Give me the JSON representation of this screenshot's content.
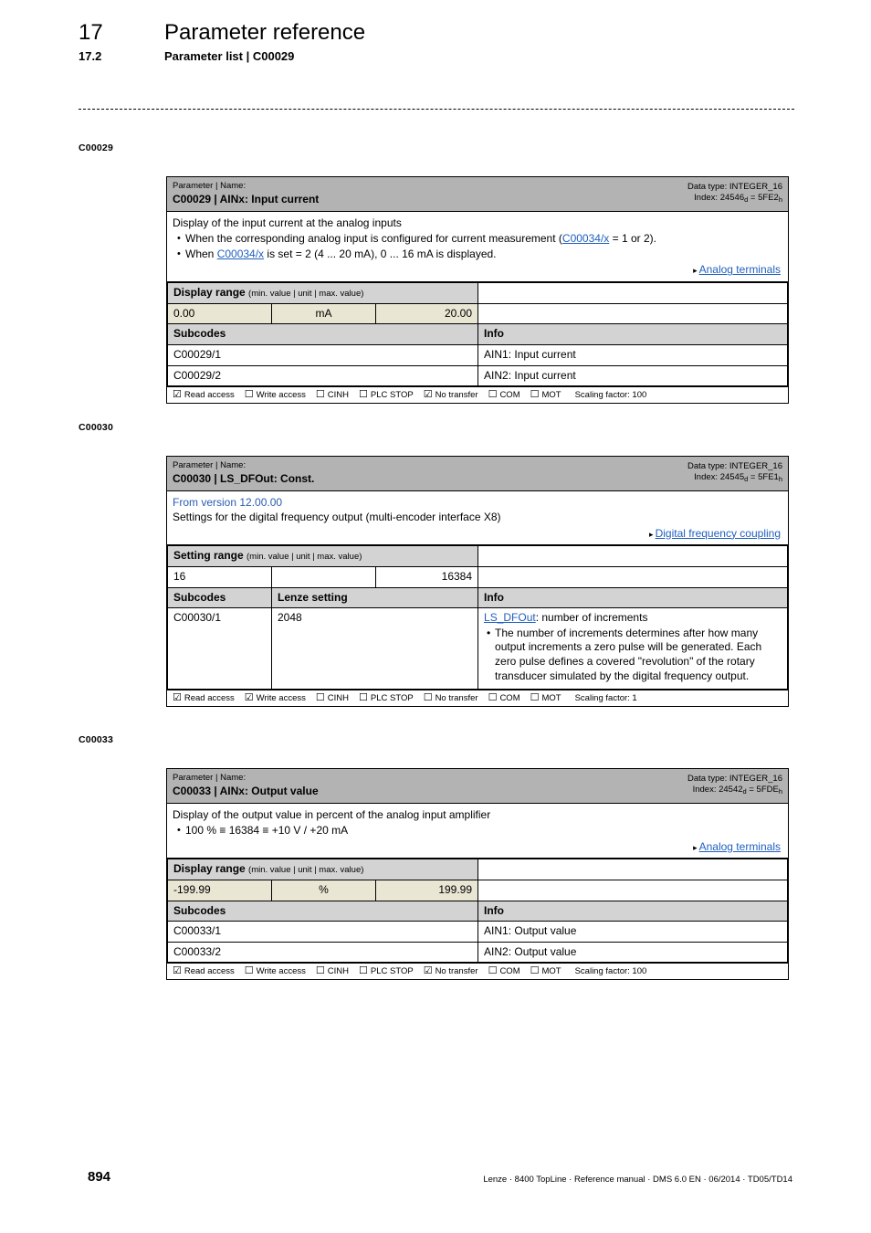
{
  "header": {
    "chapter_number": "17",
    "chapter_title": "Parameter reference",
    "section_number": "17.2",
    "section_title": "Parameter list | C00029"
  },
  "colors": {
    "band_gray": "#b3b3b3",
    "subhead_gray": "#d3d3d3",
    "value_beige": "#e9e6d4",
    "link_blue": "#1f5fbf",
    "version_blue": "#2a5db0"
  },
  "blocks": [
    {
      "gutter_label": "C00029",
      "band": {
        "caption": "Parameter | Name:",
        "name": "C00029 | AINx: Input current",
        "data_type": "Data type: INTEGER_16",
        "index_prefix": "Index: 24546",
        "index_dec_sub": "d",
        "index_eq": " = 5FE2",
        "index_hex_sub": "h"
      },
      "description": {
        "version": "",
        "lead": "Display of the input current at the analog inputs",
        "bullets": [
          "When the corresponding analog input is configured for current measurement (C00034/x = 1 or 2).",
          "When C00034/x is set = 2 (4 ... 20 mA), 0 ... 16 mA is displayed."
        ],
        "xref": "Analog terminals"
      },
      "range": {
        "header_bold": "Display range",
        "header_small": "(min. value | unit | max. value)",
        "min": "0.00",
        "unit": "mA",
        "max": "20.00",
        "shaded": true
      },
      "subcodes_header": {
        "col1": "Subcodes",
        "col2": "",
        "info": "Info"
      },
      "has_lenze_col": false,
      "rows": [
        {
          "subcode": "C00029/1",
          "lenze": "",
          "info_title": "AIN1: Input current",
          "info_bullets": []
        },
        {
          "subcode": "C00029/2",
          "lenze": "",
          "info_title": "AIN2: Input current",
          "info_bullets": []
        }
      ],
      "flags": [
        {
          "label": "Read access",
          "checked": true
        },
        {
          "label": "Write access",
          "checked": false
        },
        {
          "label": "CINH",
          "checked": false
        },
        {
          "label": "PLC STOP",
          "checked": false
        },
        {
          "label": "No transfer",
          "checked": true
        },
        {
          "label": "COM",
          "checked": false
        },
        {
          "label": "MOT",
          "checked": false
        }
      ],
      "scaling": "Scaling factor: 100"
    },
    {
      "gutter_label": "C00030",
      "band": {
        "caption": "Parameter | Name:",
        "name": "C00030 | LS_DFOut: Const.",
        "data_type": "Data type: INTEGER_16",
        "index_prefix": "Index: 24545",
        "index_dec_sub": "d",
        "index_eq": " = 5FE1",
        "index_hex_sub": "h"
      },
      "description": {
        "version": "From version 12.00.00",
        "lead": "Settings for the digital frequency output (multi-encoder interface X8)",
        "bullets": [],
        "xref": "Digital frequency coupling"
      },
      "range": {
        "header_bold": "Setting range",
        "header_small": "(min. value | unit | max. value)",
        "min": "16",
        "unit": "",
        "max": "16384",
        "shaded": false
      },
      "subcodes_header": {
        "col1": "Subcodes",
        "col2": "Lenze setting",
        "info": "Info"
      },
      "has_lenze_col": true,
      "rows": [
        {
          "subcode": "C00030/1",
          "lenze": "2048",
          "info_title": "LS_DFOut: number of increments",
          "info_title_link": "LS_DFOut",
          "info_title_rest": ": number of increments",
          "info_bullets": [
            "The number of increments determines after how many output increments a zero pulse will be generated. Each zero pulse defines a covered \"revolution\" of the rotary transducer simulated by the digital frequency output."
          ]
        }
      ],
      "flags": [
        {
          "label": "Read access",
          "checked": true
        },
        {
          "label": "Write access",
          "checked": true
        },
        {
          "label": "CINH",
          "checked": false
        },
        {
          "label": "PLC STOP",
          "checked": false
        },
        {
          "label": "No transfer",
          "checked": false
        },
        {
          "label": "COM",
          "checked": false
        },
        {
          "label": "MOT",
          "checked": false
        }
      ],
      "scaling": "Scaling factor: 1"
    },
    {
      "gutter_label": "C00033",
      "band": {
        "caption": "Parameter | Name:",
        "name": "C00033 | AINx: Output value",
        "data_type": "Data type: INTEGER_16",
        "index_prefix": "Index: 24542",
        "index_dec_sub": "d",
        "index_eq": " = 5FDE",
        "index_hex_sub": "h"
      },
      "description": {
        "version": "",
        "lead": "Display of the output value in percent of the analog input amplifier",
        "bullets": [
          "100 % ≡ 16384 ≡ +10 V / +20 mA"
        ],
        "xref": "Analog terminals"
      },
      "range": {
        "header_bold": "Display range",
        "header_small": "(min. value | unit | max. value)",
        "min": "-199.99",
        "unit": "%",
        "max": "199.99",
        "shaded": true
      },
      "subcodes_header": {
        "col1": "Subcodes",
        "col2": "",
        "info": "Info"
      },
      "has_lenze_col": false,
      "rows": [
        {
          "subcode": "C00033/1",
          "lenze": "",
          "info_title": "AIN1: Output value",
          "info_bullets": []
        },
        {
          "subcode": "C00033/2",
          "lenze": "",
          "info_title": "AIN2: Output value",
          "info_bullets": []
        }
      ],
      "flags": [
        {
          "label": "Read access",
          "checked": true
        },
        {
          "label": "Write access",
          "checked": false
        },
        {
          "label": "CINH",
          "checked": false
        },
        {
          "label": "PLC STOP",
          "checked": false
        },
        {
          "label": "No transfer",
          "checked": true
        },
        {
          "label": "COM",
          "checked": false
        },
        {
          "label": "MOT",
          "checked": false
        }
      ],
      "scaling": "Scaling factor: 100"
    }
  ],
  "footer": {
    "page_number": "894",
    "imprint": "Lenze · 8400 TopLine · Reference manual · DMS 6.0 EN · 06/2014 · TD05/TD14"
  },
  "icons": {
    "checked_box": "☑",
    "unchecked_box": "☐",
    "xref_arrow": "▸"
  }
}
